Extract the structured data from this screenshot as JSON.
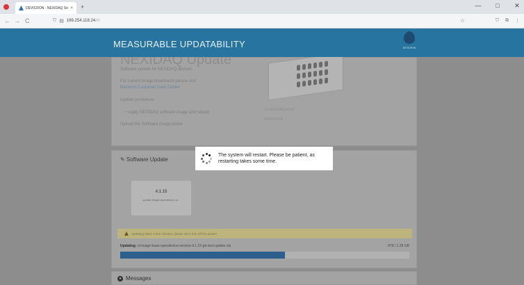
{
  "browser": {
    "tab_title": "DEVICRON - NEXIDAQ Soft...",
    "tab_close": "×",
    "new_tab": "+",
    "url": "169.254.118.24",
    "url_suffix": "/#/",
    "back": "←",
    "forward": "→",
    "reload": "C",
    "star": "☆",
    "win_minimize": "—",
    "win_maximize": "□",
    "win_close": "✕"
  },
  "header": {
    "title": "MEASURABLE UPDATABILITY",
    "logo_text": "DEVICRON"
  },
  "intro_panel": {
    "heading": "NEXIDAQ Update",
    "line1": "Software update for NEXIDAQ devices.",
    "line2": "For current image downloads please visit",
    "link": "Devicron Customer Care Center",
    "line3": "Update procedure:",
    "bullet": "• Apply NEXIDAQ software image and reboot",
    "line4": "Upload the Software image below",
    "device_caption1": "IS NEXIDAQ-ECAT",
    "device_caption2": "DEVICRON"
  },
  "update_panel": {
    "title": "✎ Software Update",
    "tile_version": "4.1.15",
    "tile_desc": "update-image-opendevice-w...",
    "warning": "Updating takes a few minutes, please don't turn off the power!",
    "updating_label": "Updating:",
    "updating_file": "nl-image-base-opendevice-version-4.1.15-git-nexi.update.zip",
    "progress_count": "878 / 1.28 GB",
    "progress_fraction": 0.57
  },
  "messages": {
    "title": "Messages"
  },
  "modal": {
    "text": "The system will restart. Please be patient, as restarting takes some time."
  }
}
